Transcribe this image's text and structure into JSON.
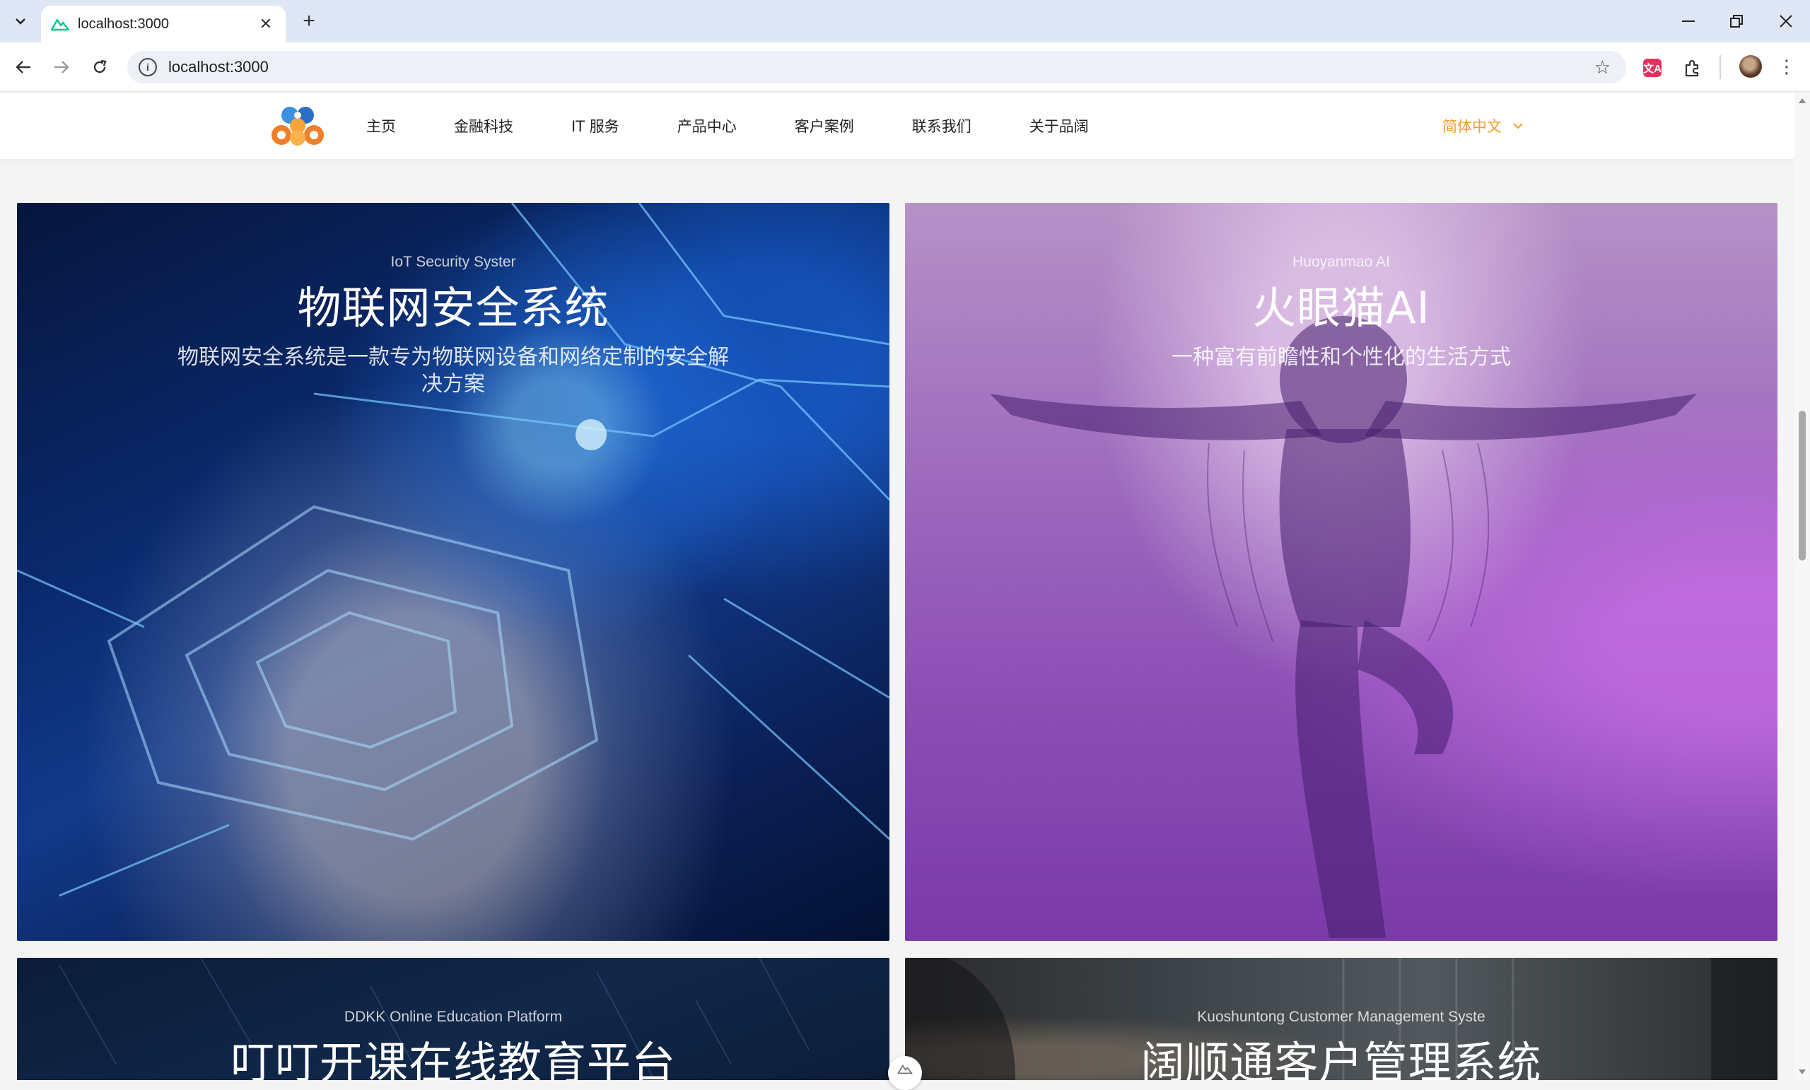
{
  "browser": {
    "tab_title": "localhost:3000",
    "url": "localhost:3000",
    "new_tab_symbol": "+",
    "close_symbol": "✕",
    "translate_ext_label": "文A"
  },
  "header": {
    "nav": [
      "主页",
      "金融科技",
      "IT 服务",
      "产品中心",
      "客户案例",
      "联系我们",
      "关于品阔"
    ],
    "language": "简体中文",
    "accent_color": "#f39c2b"
  },
  "cards": [
    {
      "subtitle": "IoT Security Syster",
      "title": "物联网安全系统",
      "desc_line1": "物联网安全系统是一款专为物联网设备和网络定制的安全解",
      "desc_line2": "决方案"
    },
    {
      "subtitle": "Huoyanmao AI",
      "title": "火眼猫AI",
      "desc_line1": "一种富有前瞻性和个性化的生活方式"
    },
    {
      "subtitle": "DDKK Online Education Platform",
      "title": "叮叮开课在线教育平台"
    },
    {
      "subtitle": "Kuoshuntong Customer Management Syste",
      "title": "阔顺通客户管理系统"
    }
  ],
  "icons": [
    "tab-search-icon",
    "favicon-icon",
    "back-icon",
    "forward-icon",
    "reload-icon",
    "site-info-icon",
    "bookmark-star-icon",
    "extensions-icon",
    "chevron-down-icon",
    "logo-icon"
  ]
}
